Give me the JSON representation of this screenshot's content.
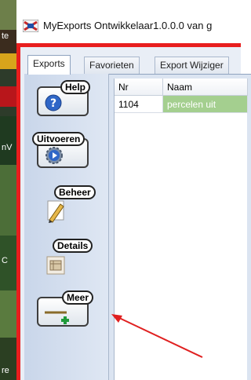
{
  "window": {
    "title": "MyExports Ontwikkelaar1.0.0.0  van g"
  },
  "tabs": [
    {
      "label": "Exports",
      "active": true
    },
    {
      "label": "Favorieten",
      "active": false
    },
    {
      "label": "Export Wijziger",
      "active": false
    }
  ],
  "toolbar": {
    "help_label": "Help",
    "run_label": "Uitvoeren",
    "manage_label": "Beheer",
    "details_label": "Details",
    "more_label": "Meer"
  },
  "grid": {
    "columns": [
      "Nr",
      "Naam"
    ],
    "rows": [
      {
        "nr": "1104",
        "naam": "percelen uit"
      }
    ]
  },
  "desktop": {
    "fragments": [
      "te",
      "nV",
      "C",
      "re"
    ]
  },
  "colors": {
    "accent_red": "#e81e1e",
    "selected_row": "#a4cf8f",
    "panel_blue": "#dbe4f1"
  },
  "icons": {
    "app": "myexports-app-icon",
    "help": "question-icon",
    "run": "gear-play-icon",
    "manage": "pencil-paper-icon",
    "details": "document-details-icon",
    "more": "plus-minus-icon"
  }
}
